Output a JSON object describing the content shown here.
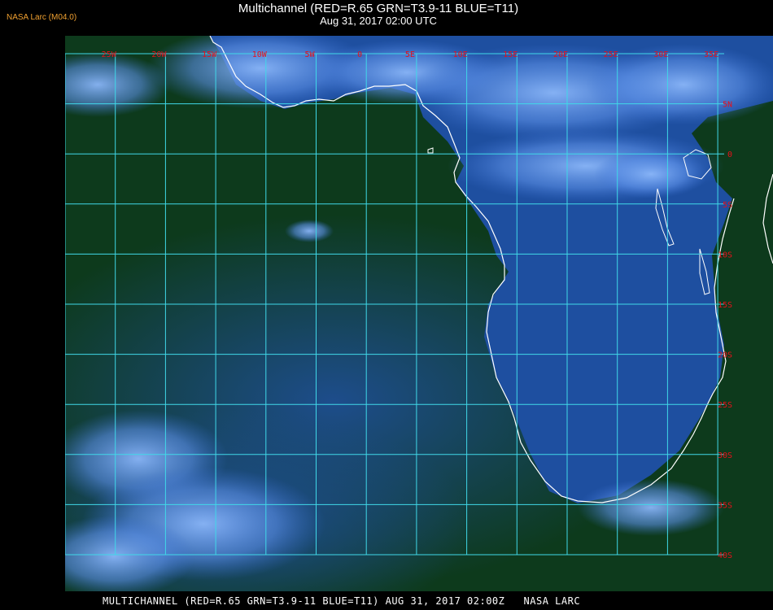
{
  "header": {
    "corner_label": "NASA Larc (M04.0)",
    "title": "Multichannel (RED=R.65 GRN=T3.9-11 BLUE=T11)",
    "subtitle": "Aug 31, 2017 02:00 UTC"
  },
  "map": {
    "lon_labels": [
      "25W",
      "20W",
      "15W",
      "10W",
      "5W",
      "0",
      "5E",
      "10E",
      "15E",
      "20E",
      "25E",
      "30E",
      "35E"
    ],
    "lat_labels": [
      "5N",
      "0",
      "5S",
      "10S",
      "15S",
      "20S",
      "25S",
      "30S",
      "35S",
      "40S"
    ],
    "colors": {
      "grid": "#40d8e8",
      "tick_label": "#e8101a",
      "coastline": "#ffffff",
      "ocean_dark": "#0d3a1c",
      "ocean_blue": "#1c4a8a",
      "land": "#1e4fa0",
      "cloud": "#6fa2f2"
    }
  },
  "footer": {
    "text": "MULTICHANNEL (RED=R.65 GRN=T3.9-11 BLUE=T11) AUG 31, 2017 02:00Z   NASA LARC"
  }
}
